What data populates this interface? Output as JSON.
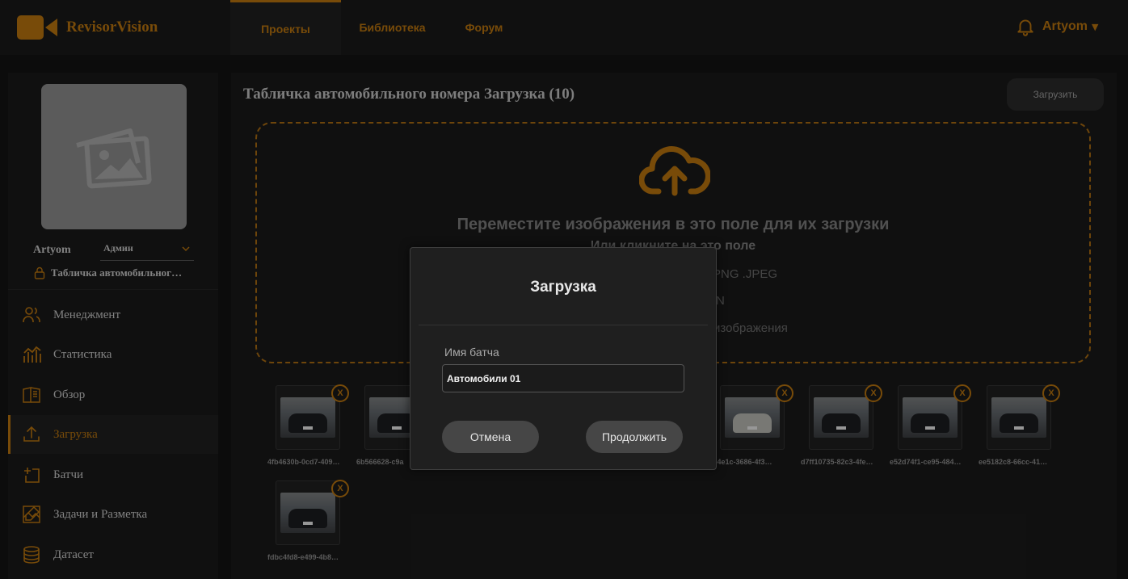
{
  "header": {
    "app_name": "RevisorVision",
    "tabs": [
      {
        "label": "Проекты"
      },
      {
        "label": "Библиотека"
      },
      {
        "label": "Форум"
      }
    ],
    "user_name": "Artyom",
    "accent_color": "#b8740f"
  },
  "sidebar": {
    "user_name": "Artyom",
    "role": "Админ",
    "project": "Табличка автомобильног…",
    "items": [
      {
        "label": "Менеджмент",
        "icon": "users-icon"
      },
      {
        "label": "Статистика",
        "icon": "chart-icon"
      },
      {
        "label": "Обзор",
        "icon": "book-icon"
      },
      {
        "label": "Загрузка",
        "icon": "upload-icon",
        "active": true
      },
      {
        "label": "Батчи",
        "icon": "add-batch-icon"
      },
      {
        "label": "Задачи и Разметка",
        "icon": "annotate-icon"
      },
      {
        "label": "Датасет",
        "icon": "database-icon"
      }
    ]
  },
  "main": {
    "title": "Табличка автомобильного номера Загрузка (10)",
    "upload_button": "Загрузить",
    "dropzone": {
      "title": "Переместите изображения в это поле для их загрузки",
      "subtitle": "Или кликните на это поле",
      "line1_visible": "PNG .JPEG",
      "line2_visible": "N",
      "line3_visible": "изображения"
    },
    "thumbnails": [
      {
        "label": "4fb4630b-0cd7-409…"
      },
      {
        "label": "6b566628-c9a"
      },
      {
        "label": "80d4e1c-3686-4f3…"
      },
      {
        "label": "d7ff10735-82c3-4fe…"
      },
      {
        "label": "e52d74f1-ce95-484…"
      },
      {
        "label": "ee5182c8-66cc-41…"
      },
      {
        "label": "fdbc4fd8-e499-4b8…"
      }
    ],
    "remove_label": "X"
  },
  "modal": {
    "title": "Загрузка",
    "field_label": "Имя батча",
    "field_value": "Автомобили 01",
    "cancel_label": "Отмена",
    "continue_label": "Продолжить"
  }
}
